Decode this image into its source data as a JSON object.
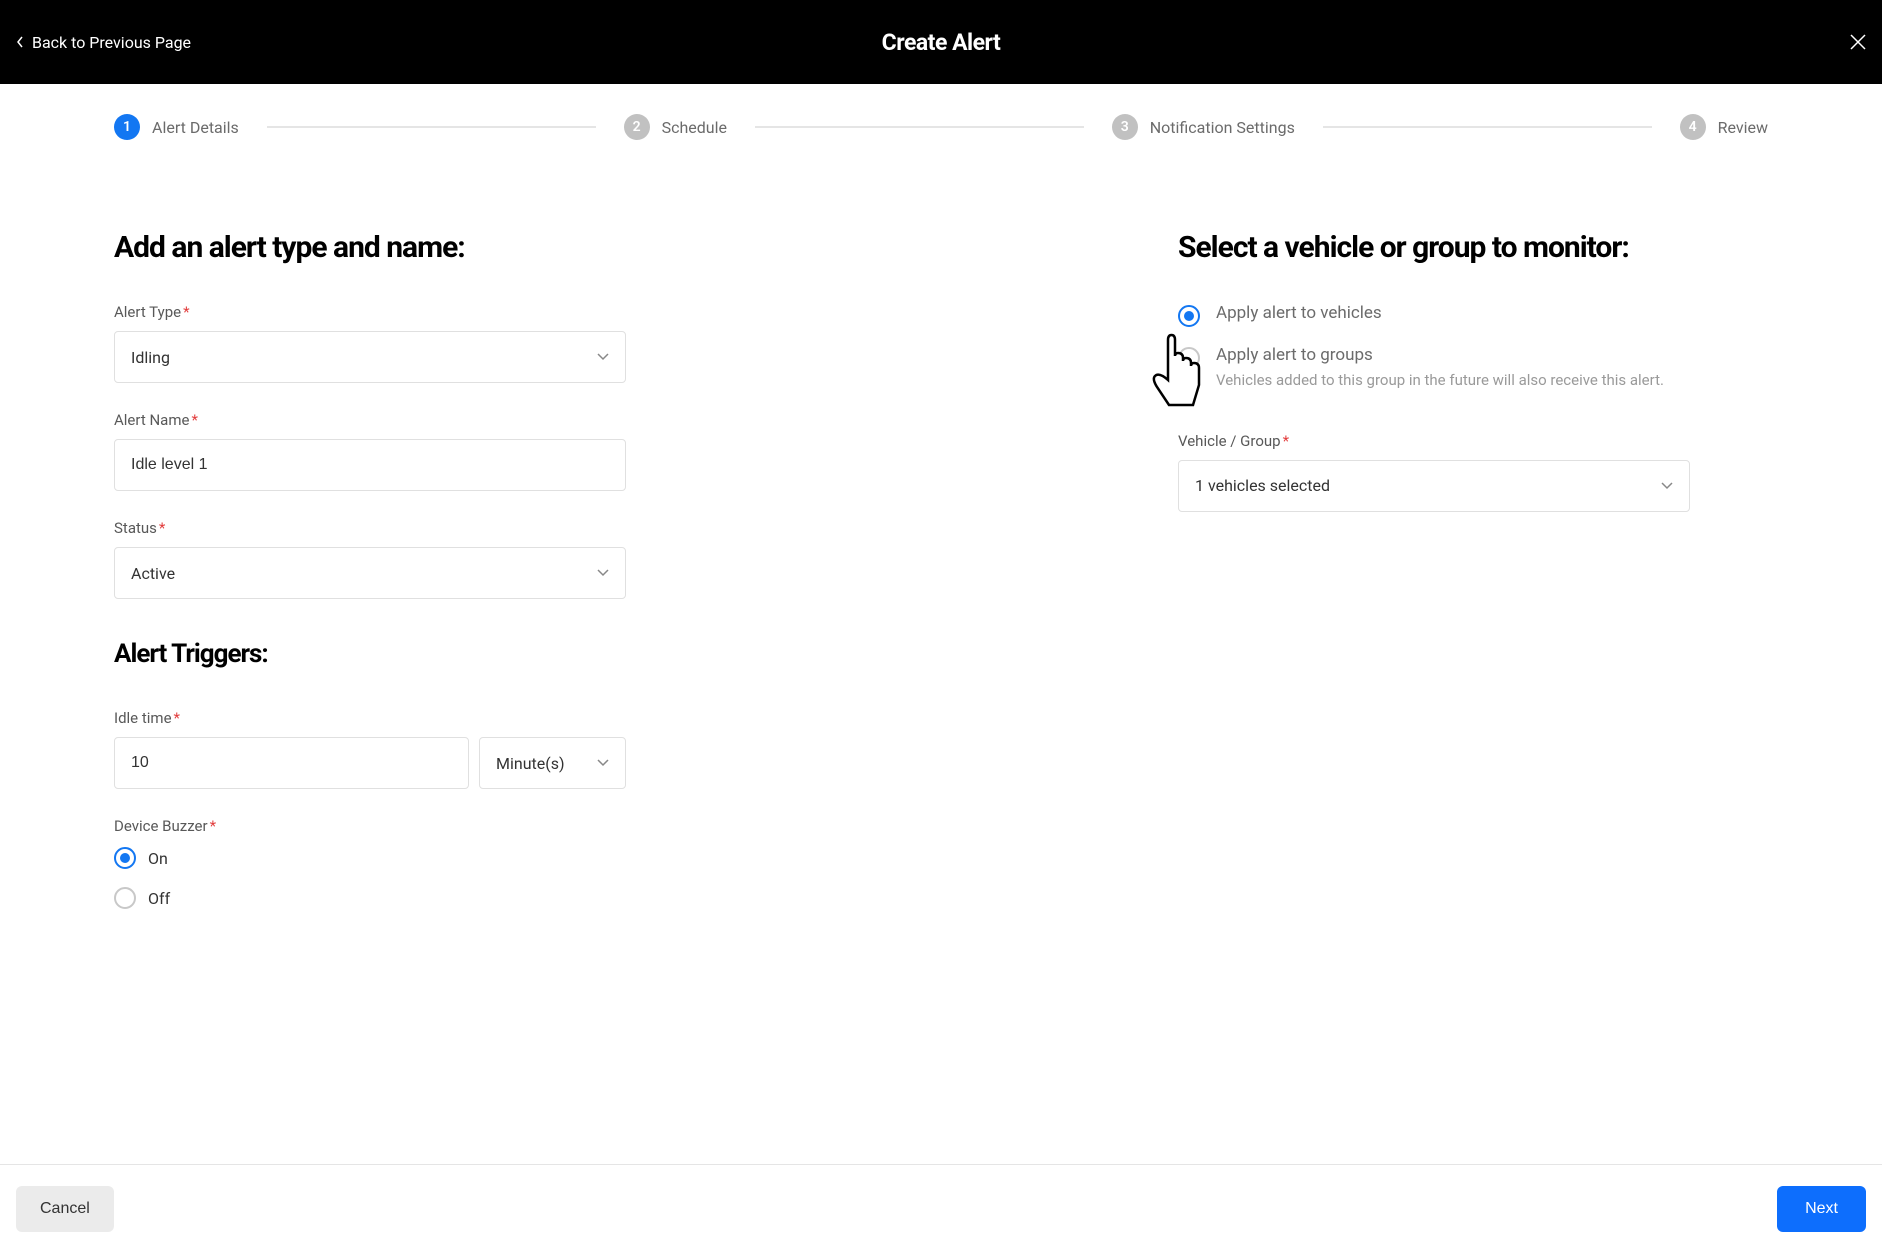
{
  "header": {
    "back_label": "Back to Previous Page",
    "title": "Create Alert"
  },
  "stepper": {
    "steps": [
      {
        "num": "1",
        "label": "Alert Details",
        "active": true
      },
      {
        "num": "2",
        "label": "Schedule",
        "active": false
      },
      {
        "num": "3",
        "label": "Notification Settings",
        "active": false
      },
      {
        "num": "4",
        "label": "Review",
        "active": false
      }
    ]
  },
  "left": {
    "title": "Add an alert type and name:",
    "alert_type_label": "Alert Type",
    "alert_type_value": "Idling",
    "alert_name_label": "Alert Name",
    "alert_name_value": "Idle level 1",
    "status_label": "Status",
    "status_value": "Active",
    "triggers_title": "Alert Triggers:",
    "idle_time_label": "Idle time",
    "idle_time_value": "10",
    "idle_time_unit": "Minute(s)",
    "device_buzzer_label": "Device Buzzer",
    "buzzer_on": "On",
    "buzzer_off": "Off"
  },
  "right": {
    "title": "Select a vehicle or group to monitor:",
    "apply_vehicles": "Apply alert to vehicles",
    "apply_groups": "Apply alert to groups",
    "groups_hint": "Vehicles added to this group in the future will also receive this alert.",
    "vehicle_group_label": "Vehicle / Group",
    "vehicle_group_value": "1 vehicles selected"
  },
  "footer": {
    "cancel": "Cancel",
    "next": "Next"
  }
}
